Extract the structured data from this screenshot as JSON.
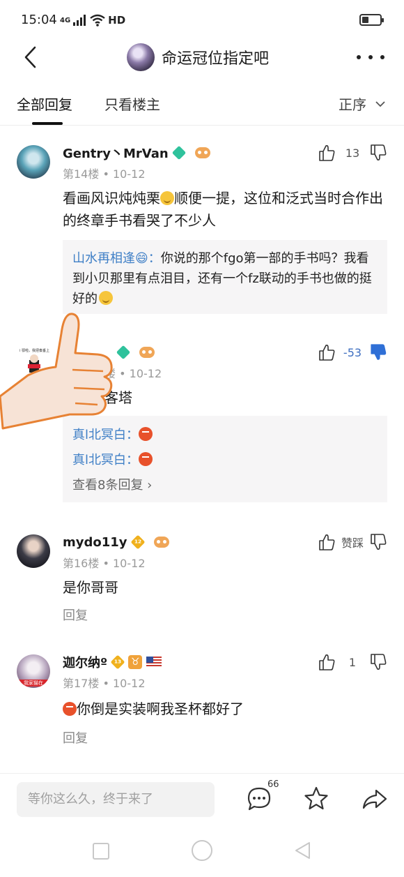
{
  "status_bar": {
    "time": "15:04",
    "network": "4G",
    "quality": "HD"
  },
  "nav": {
    "title": "命运冠位指定吧"
  },
  "tabs": {
    "all": "全部回复",
    "owner_only": "只看楼主",
    "sort": "正序"
  },
  "posts": [
    {
      "username": "Gentry丶MrVan",
      "floor": "第14楼",
      "date": "10-12",
      "likes": "13",
      "content_before": "看画风识炖炖栗",
      "content_after": "顺便一提，这位和泛式当时合作出的终章手书看哭了不少人",
      "quote_author": "山水再相逢😄：",
      "quote_text": "你说的那个fgo第一部的手书吗？我看到小贝那里有点泪目，还有一个fz联动的手书也做的挺好的"
    },
    {
      "username": "",
      "floor_partial": "楼",
      "date": "10-12",
      "likes": "-53",
      "content": "是刀客塔",
      "sub_replies": [
        {
          "author": "真l北冥白："
        },
        {
          "author": "真l北冥白："
        }
      ],
      "view_more": "查看8条回复"
    },
    {
      "username": "mydo11y",
      "level": "12",
      "gamepad_level": "5",
      "floor": "第16楼",
      "date": "10-12",
      "vote_label": "赞踩",
      "content": "是你哥哥",
      "reply_label": "回复"
    },
    {
      "username": "迦尔纳º",
      "level": "13",
      "zodiac": "♉",
      "floor": "第17楼",
      "date": "10-12",
      "likes": "1",
      "content": "你倒是实装啊我圣杯都好了",
      "reply_label": "回复",
      "avatar_tag": "我家猫在"
    }
  ],
  "meta_sep": "•",
  "bottom": {
    "placeholder": "等你这么久，终于来了",
    "comment_count": "66"
  },
  "colors": {
    "link": "#3f7fc6",
    "downvote_active": "#2f6fd6",
    "quote_bg": "#f6f5f6"
  }
}
